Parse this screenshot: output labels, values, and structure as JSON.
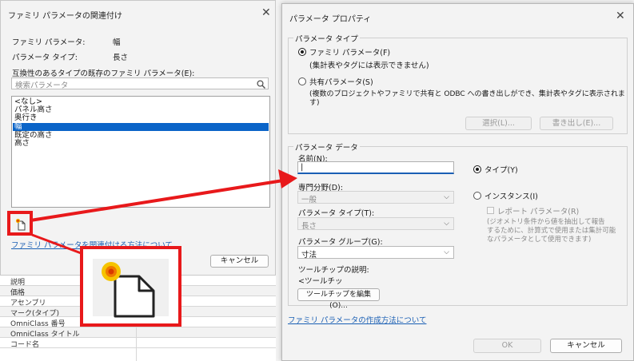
{
  "left_dialog": {
    "title": "ファミリ パラメータの関連付け",
    "close": "✕",
    "family_param_label": "ファミリ パラメータ:",
    "family_param_value": "幅",
    "param_type_label": "パラメータ タイプ:",
    "param_type_value": "長さ",
    "existing_label": "互換性のあるタイプの既存のファミリ パラメータ(E):",
    "search_placeholder": "検索パラメータ",
    "list_items": [
      "<なし>",
      "パネル高さ",
      "奥行き",
      "幅",
      "既定の高さ",
      "高さ"
    ],
    "selected_index": 3,
    "link_text": "ファミリ パラメータを関連付ける方法について",
    "cancel_label": "キャンセル"
  },
  "property_rows": [
    "説明",
    "価格",
    "アセンブリ",
    "マーク(タイプ)",
    "OmniClass 番号",
    "OmniClass タイトル",
    "コード名"
  ],
  "right_dialog": {
    "title": "パラメータ プロパティ",
    "close": "✕",
    "param_type_group": "パラメータ タイプ",
    "family_param_option": "ファミリ パラメータ(F)",
    "family_param_note": "(集計表やタグには表示できません)",
    "shared_param_option": "共有パラメータ(S)",
    "shared_param_note_1": "(複数のプロジェクトやファミリで共有と ODBC への書き出しができ、集計表やタグに表示されま",
    "shared_param_note_2": "す)",
    "select_button": "選択(L)...",
    "export_button": "書き出し(E)...",
    "param_data_group": "パラメータ データ",
    "name_label": "名前(N):",
    "name_value": "|",
    "discipline_label": "専門分野(D):",
    "discipline_value": "一般",
    "param_type_label": "パラメータ タイプ(T):",
    "param_type_value": "長さ",
    "param_group_label": "パラメータ グループ(G):",
    "param_group_value": "寸法",
    "type_option": "タイプ(Y)",
    "instance_option": "インスタンス(I)",
    "report_param_label": "レポート パラメータ(R)",
    "report_note_1": "(ジオメトリ条件から値を抽出して報告",
    "report_note_2": "するために、計算式で使用または集計可能",
    "report_note_3": "なパラメータとして使用できます)",
    "tooltip_label": "ツールチップの説明:",
    "tooltip_value": "<ツールチッ",
    "tooltip_edit_button": "ツールチップを編集(O)...",
    "link_text": "ファミリ パラメータの作成方法について",
    "ok_label": "OK",
    "cancel_label": "キャンセル"
  },
  "colors": {
    "accent": "#0a64c8",
    "annotation": "#e8191b",
    "link": "#1a5fb4"
  },
  "icons": [
    "new-parameter-icon",
    "search-icon",
    "close-icon",
    "chevron-down-icon"
  ]
}
